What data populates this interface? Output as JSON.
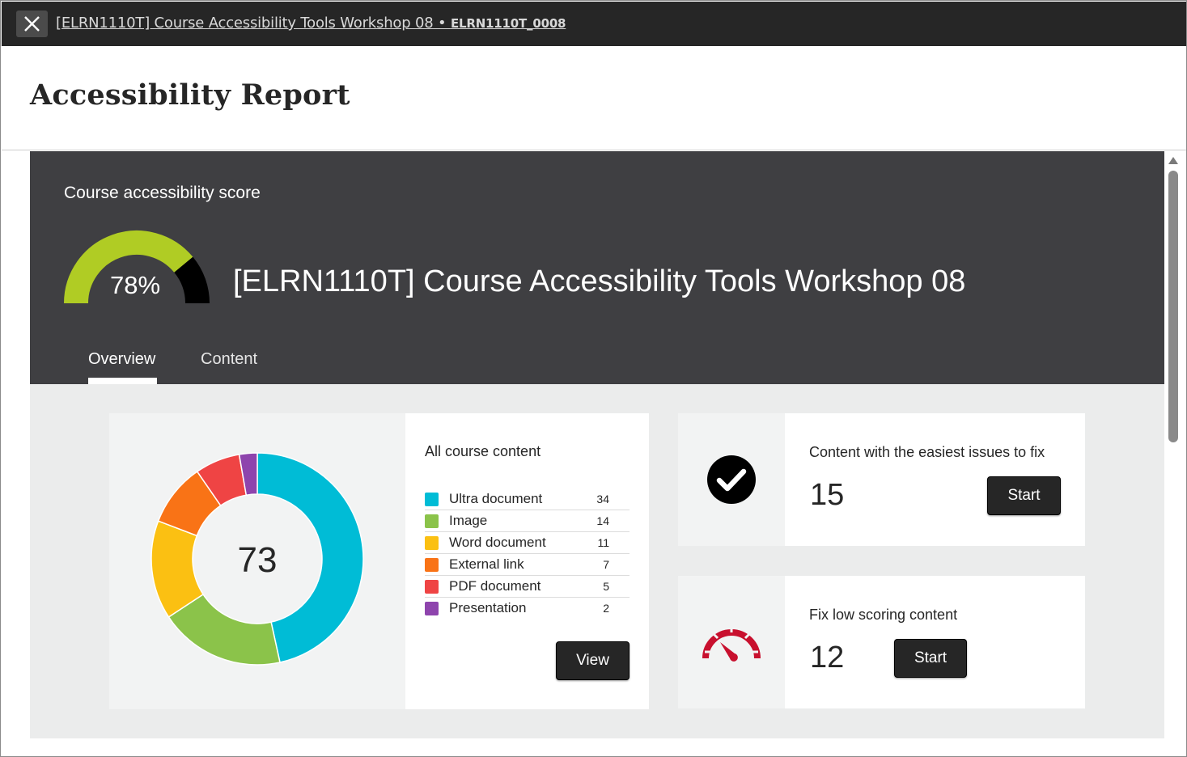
{
  "topbar": {
    "course_link": "[ELRN1110T] Course Accessibility Tools Workshop 08",
    "separator": " • ",
    "course_code": "ELRN1110T_0008"
  },
  "page": {
    "title": "Accessibility Report"
  },
  "hero": {
    "score_label": "Course accessibility score",
    "score_percent": "78%",
    "score_value": 78,
    "course_name": "[ELRN1110T] Course Accessibility Tools Workshop 08",
    "tabs": [
      {
        "label": "Overview",
        "active": true
      },
      {
        "label": "Content",
        "active": false
      }
    ],
    "colors": {
      "gauge_fill": "#b0cc24",
      "gauge_rest": "#000000",
      "background": "#3f3f42"
    }
  },
  "content_card": {
    "total": "73",
    "title": "All course content",
    "view_button": "View"
  },
  "chart_data": {
    "type": "donut",
    "center_label": "73",
    "categories": [
      "Ultra document",
      "Image",
      "Word document",
      "External link",
      "PDF document",
      "Presentation"
    ],
    "values": [
      34,
      14,
      11,
      7,
      5,
      2
    ],
    "colors": [
      "#00bcd6",
      "#8bc34a",
      "#fbc012",
      "#f97316",
      "#ef4444",
      "#8e44ad"
    ]
  },
  "tasks": [
    {
      "title": "Content with the easiest issues to fix",
      "count": "15",
      "button": "Start",
      "icon": "checkmark-circle-icon"
    },
    {
      "title": "Fix low scoring content",
      "count": "12",
      "button": "Start",
      "icon": "speedometer-icon"
    }
  ]
}
